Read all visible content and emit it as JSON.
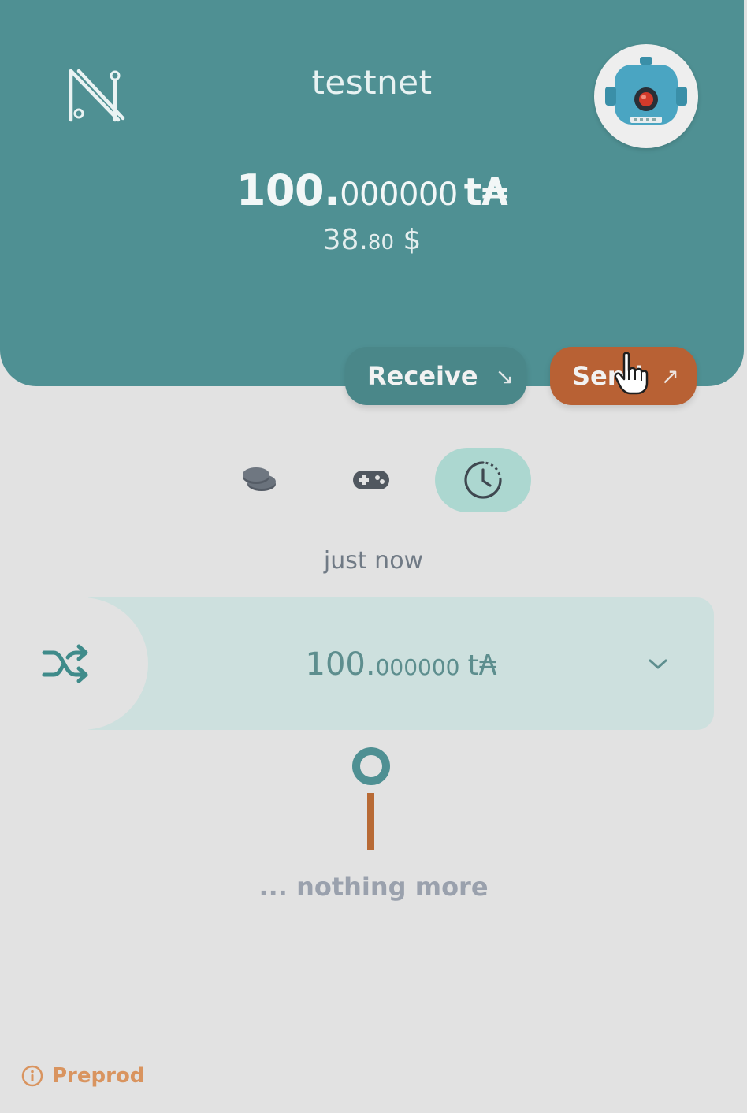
{
  "header": {
    "network_title": "testnet",
    "logo_icon": "nami-logo-icon",
    "avatar_icon": "robot-avatar-icon",
    "balance": {
      "integer": "100.",
      "decimals": "000000",
      "unit": "t₳"
    },
    "fiat": {
      "integer": "38.",
      "decimals": "80",
      "unit": "$"
    }
  },
  "actions": {
    "receive_label": "Receive",
    "receive_icon": "↘",
    "send_label": "Send",
    "send_icon": "↗"
  },
  "tabs": [
    {
      "name": "assets",
      "icon": "coins-icon",
      "active": false
    },
    {
      "name": "collectibles",
      "icon": "gamepad-icon",
      "active": false
    },
    {
      "name": "activity",
      "icon": "clock-icon",
      "active": true
    }
  ],
  "activity": {
    "timestamp": "just now",
    "transactions": [
      {
        "icon": "shuffle-icon",
        "amount_integer": "100.",
        "amount_decimals": "000000",
        "unit": "t₳"
      }
    ],
    "end_text": "... nothing more"
  },
  "footer": {
    "network_label": "Preprod",
    "icon": "info-icon"
  },
  "colors": {
    "primary_teal": "#4f9093",
    "send_orange": "#b86134",
    "active_tab": "#acd7d0",
    "tx_background": "#cde0de"
  }
}
